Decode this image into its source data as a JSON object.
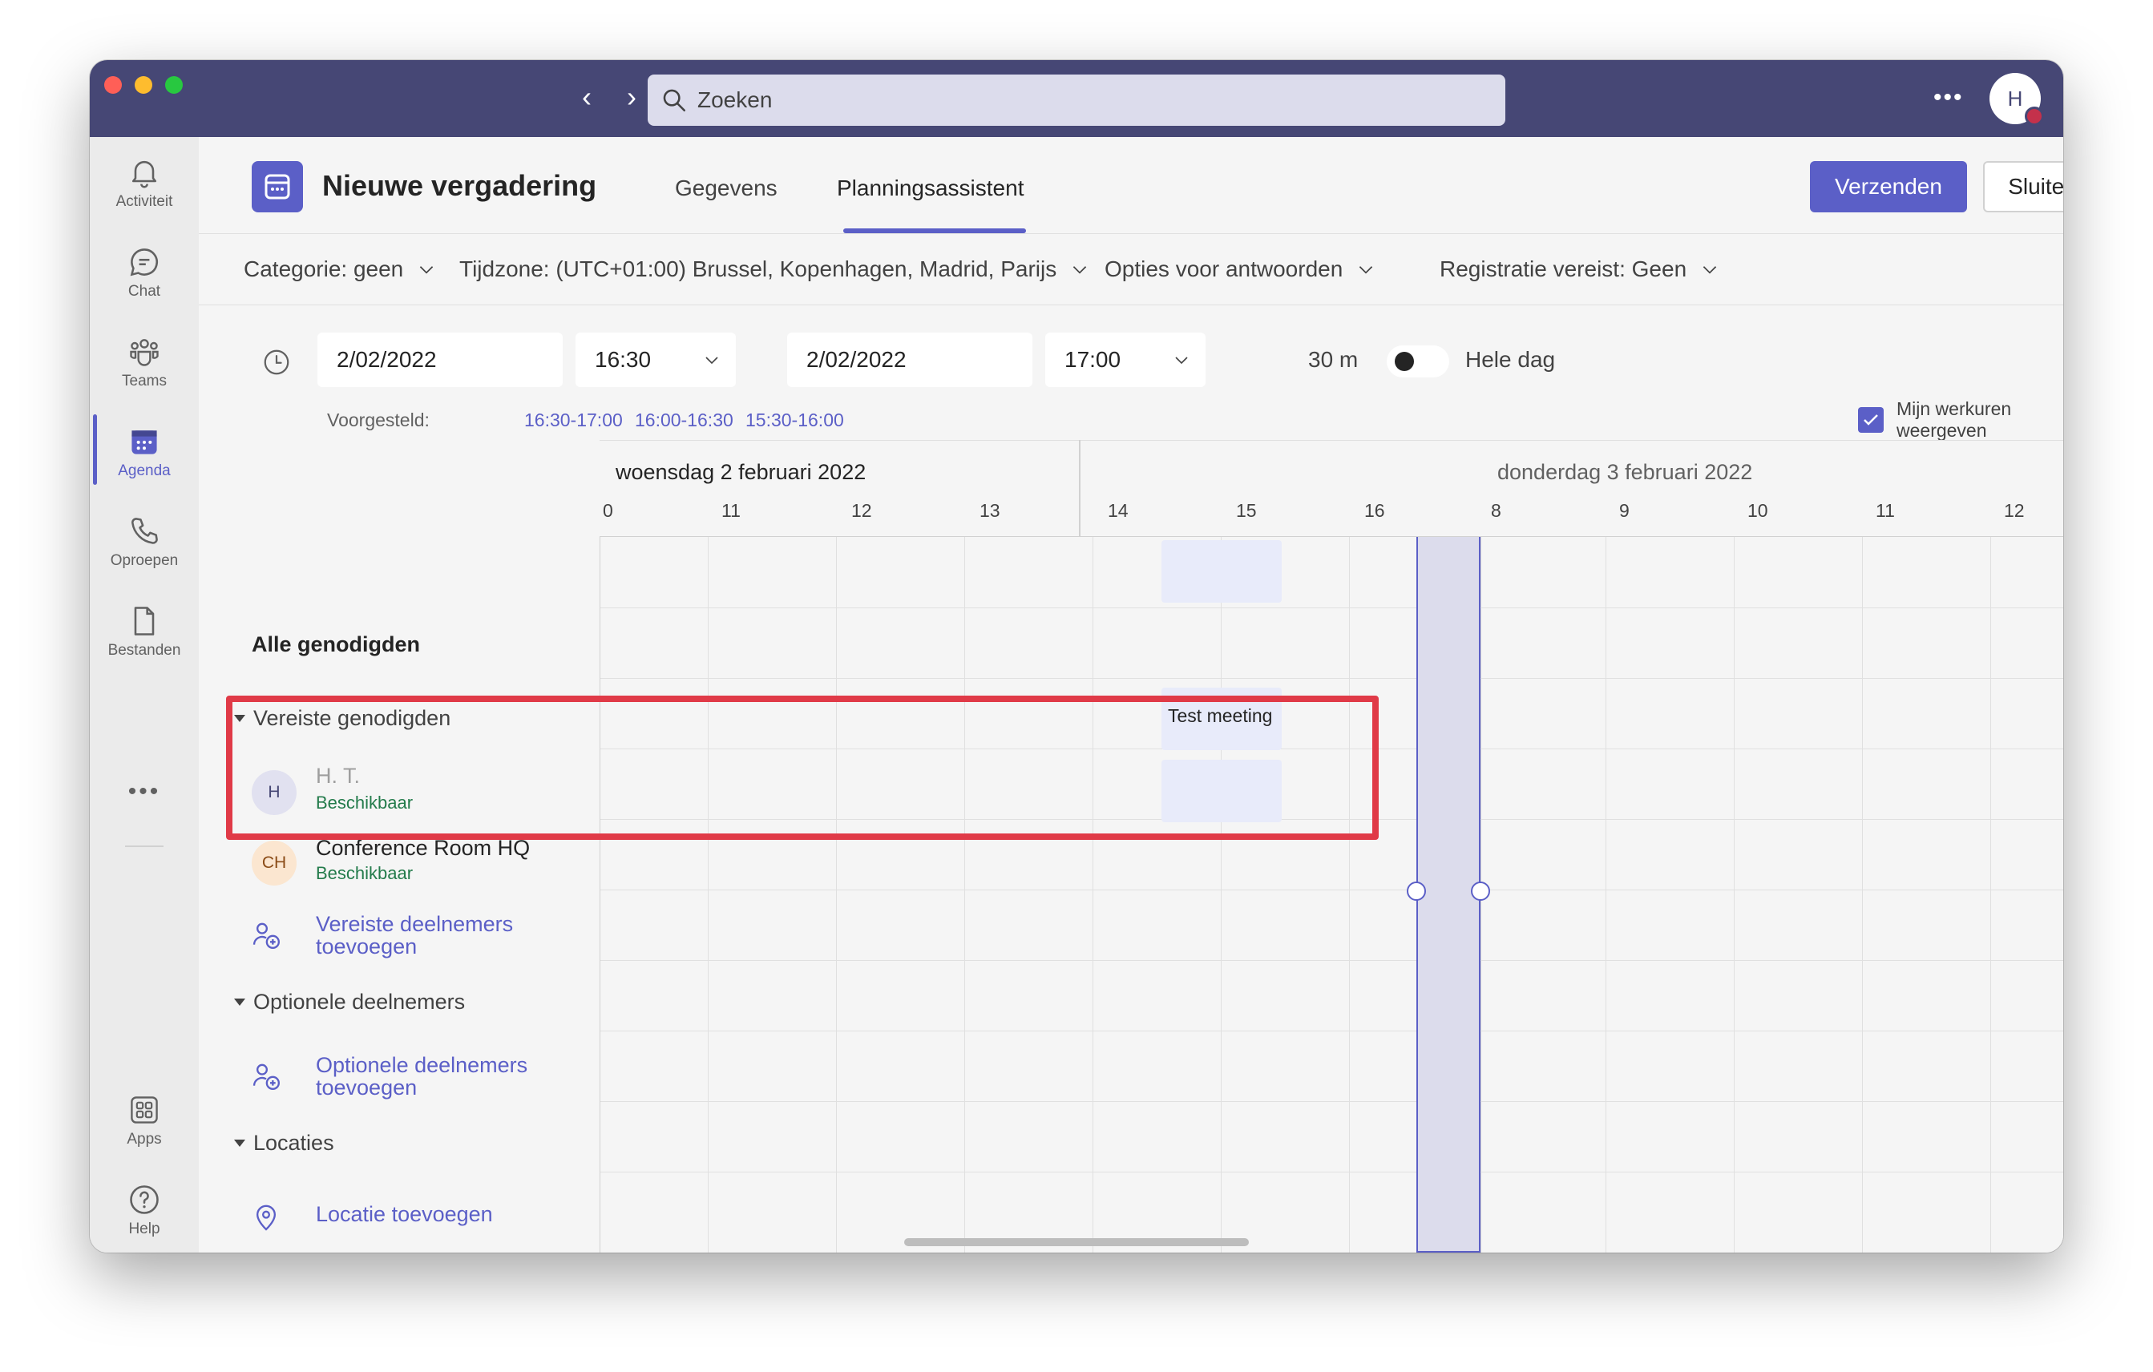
{
  "search": {
    "placeholder": "Zoeken"
  },
  "user": {
    "initial": "H"
  },
  "rail": [
    {
      "label": "Activiteit",
      "icon": "bell-icon"
    },
    {
      "label": "Chat",
      "icon": "chat-icon"
    },
    {
      "label": "Teams",
      "icon": "teams-icon"
    },
    {
      "label": "Agenda",
      "icon": "calendar-icon",
      "active": true
    },
    {
      "label": "Oproepen",
      "icon": "phone-icon"
    },
    {
      "label": "Bestanden",
      "icon": "file-icon"
    },
    {
      "label": "Apps",
      "icon": "apps-icon"
    },
    {
      "label": "Help",
      "icon": "help-icon"
    }
  ],
  "rail_more": "•••",
  "header": {
    "title": "Nieuwe vergadering",
    "tabs": [
      {
        "label": "Gegevens"
      },
      {
        "label": "Planningsassistent",
        "active": true
      }
    ],
    "send_label": "Verzenden",
    "close_label": "Sluiten"
  },
  "options": {
    "category": "Categorie: geen",
    "timezone": "Tijdzone: (UTC+01:00) Brussel, Kopenhagen, Madrid, Parijs",
    "reply": "Opties voor antwoorden",
    "registration": "Registratie vereist: Geen"
  },
  "time": {
    "start_date": "2/02/2022",
    "start_time": "16:30",
    "end_date": "2/02/2022",
    "end_time": "17:00",
    "duration": "30 m",
    "allday_label": "Hele dag",
    "allday": false,
    "suggested_label": "Voorgesteld:",
    "suggestions": [
      "16:30-17:00",
      "16:00-16:30",
      "15:30-16:00"
    ],
    "workhours_label": "Mijn werkuren weergeven",
    "workhours_checked": true
  },
  "attendees": {
    "all_label": "Alle genodigden",
    "required_label": "Vereiste genodigden",
    "people": [
      {
        "initials": "H",
        "name": "H. T.",
        "status": "Beschikbaar"
      },
      {
        "initials": "CH",
        "name": "Conference Room HQ",
        "status": "Beschikbaar"
      }
    ],
    "add_required": "Vereiste deelnemers toevoegen",
    "optional_label": "Optionele deelnemers",
    "add_optional": "Optionele deelnemers toevoegen",
    "locations_label": "Locaties",
    "add_location": "Locatie toevoegen"
  },
  "timeline": {
    "day1": "woensdag 2 februari 2022",
    "day2": "donderdag 3 februari 2022",
    "day1_hours": [
      "0",
      "11",
      "12",
      "13",
      "14",
      "15",
      "16"
    ],
    "day2_hours": [
      "8",
      "9",
      "10",
      "11",
      "12"
    ],
    "meeting_label": "Test meeting"
  },
  "colors": {
    "titlebar": "#464775",
    "accent": "#5b5fc7",
    "available": "#237b4b",
    "highlight": "#e03a47"
  }
}
